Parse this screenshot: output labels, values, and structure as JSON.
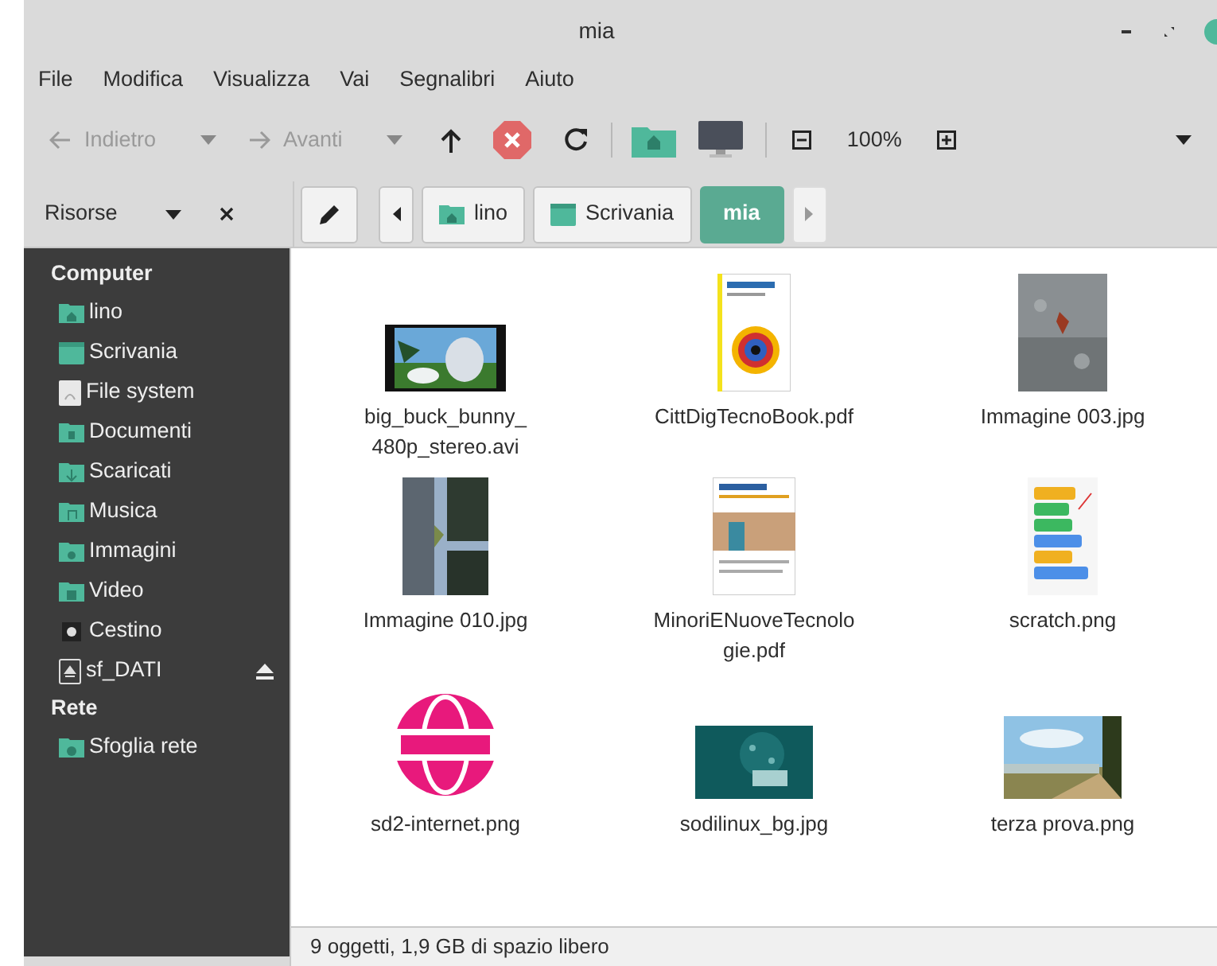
{
  "window": {
    "title": "mia"
  },
  "menu": [
    "File",
    "Modifica",
    "Visualizza",
    "Vai",
    "Segnalibri",
    "Aiuto"
  ],
  "toolbar": {
    "back": {
      "label": "Indietro",
      "disabled": true
    },
    "forward": {
      "label": "Avanti",
      "disabled": true
    },
    "zoom": "100%"
  },
  "sidebar": {
    "title": "Risorse",
    "sections": [
      {
        "heading": "Computer",
        "items": [
          {
            "label": "lino",
            "kind": "home"
          },
          {
            "label": "Scrivania",
            "kind": "desktop"
          },
          {
            "label": "File system",
            "kind": "drive"
          },
          {
            "label": "Documenti",
            "kind": "documents"
          },
          {
            "label": "Scaricati",
            "kind": "downloads"
          },
          {
            "label": "Musica",
            "kind": "music"
          },
          {
            "label": "Immagini",
            "kind": "pictures"
          },
          {
            "label": "Video",
            "kind": "videos"
          },
          {
            "label": "Cestino",
            "kind": "trash"
          },
          {
            "label": "sf_DATI",
            "kind": "volume"
          }
        ]
      },
      {
        "heading": "Rete",
        "items": [
          {
            "label": "Sfoglia rete",
            "kind": "network"
          }
        ]
      }
    ]
  },
  "path": [
    {
      "label": "lino",
      "kind": "home",
      "selected": false
    },
    {
      "label": "Scrivania",
      "kind": "desktop",
      "selected": false
    },
    {
      "label": "mia",
      "kind": "plain",
      "selected": true
    }
  ],
  "files": [
    {
      "name": "big_buck_bunny_\n480p_stereo.avi"
    },
    {
      "name": "CittDigTecnoBook.pdf"
    },
    {
      "name": "Immagine 003.jpg"
    },
    {
      "name": "Immagine 010.jpg"
    },
    {
      "name": "MinoriENuoveTecnolo\ngie.pdf"
    },
    {
      "name": "scratch.png"
    },
    {
      "name": "sd2-internet.png"
    },
    {
      "name": "sodilinux_bg.jpg"
    },
    {
      "name": "terza prova.png"
    }
  ],
  "status_bar": "9 oggetti, 1,9 GB di spazio libero"
}
